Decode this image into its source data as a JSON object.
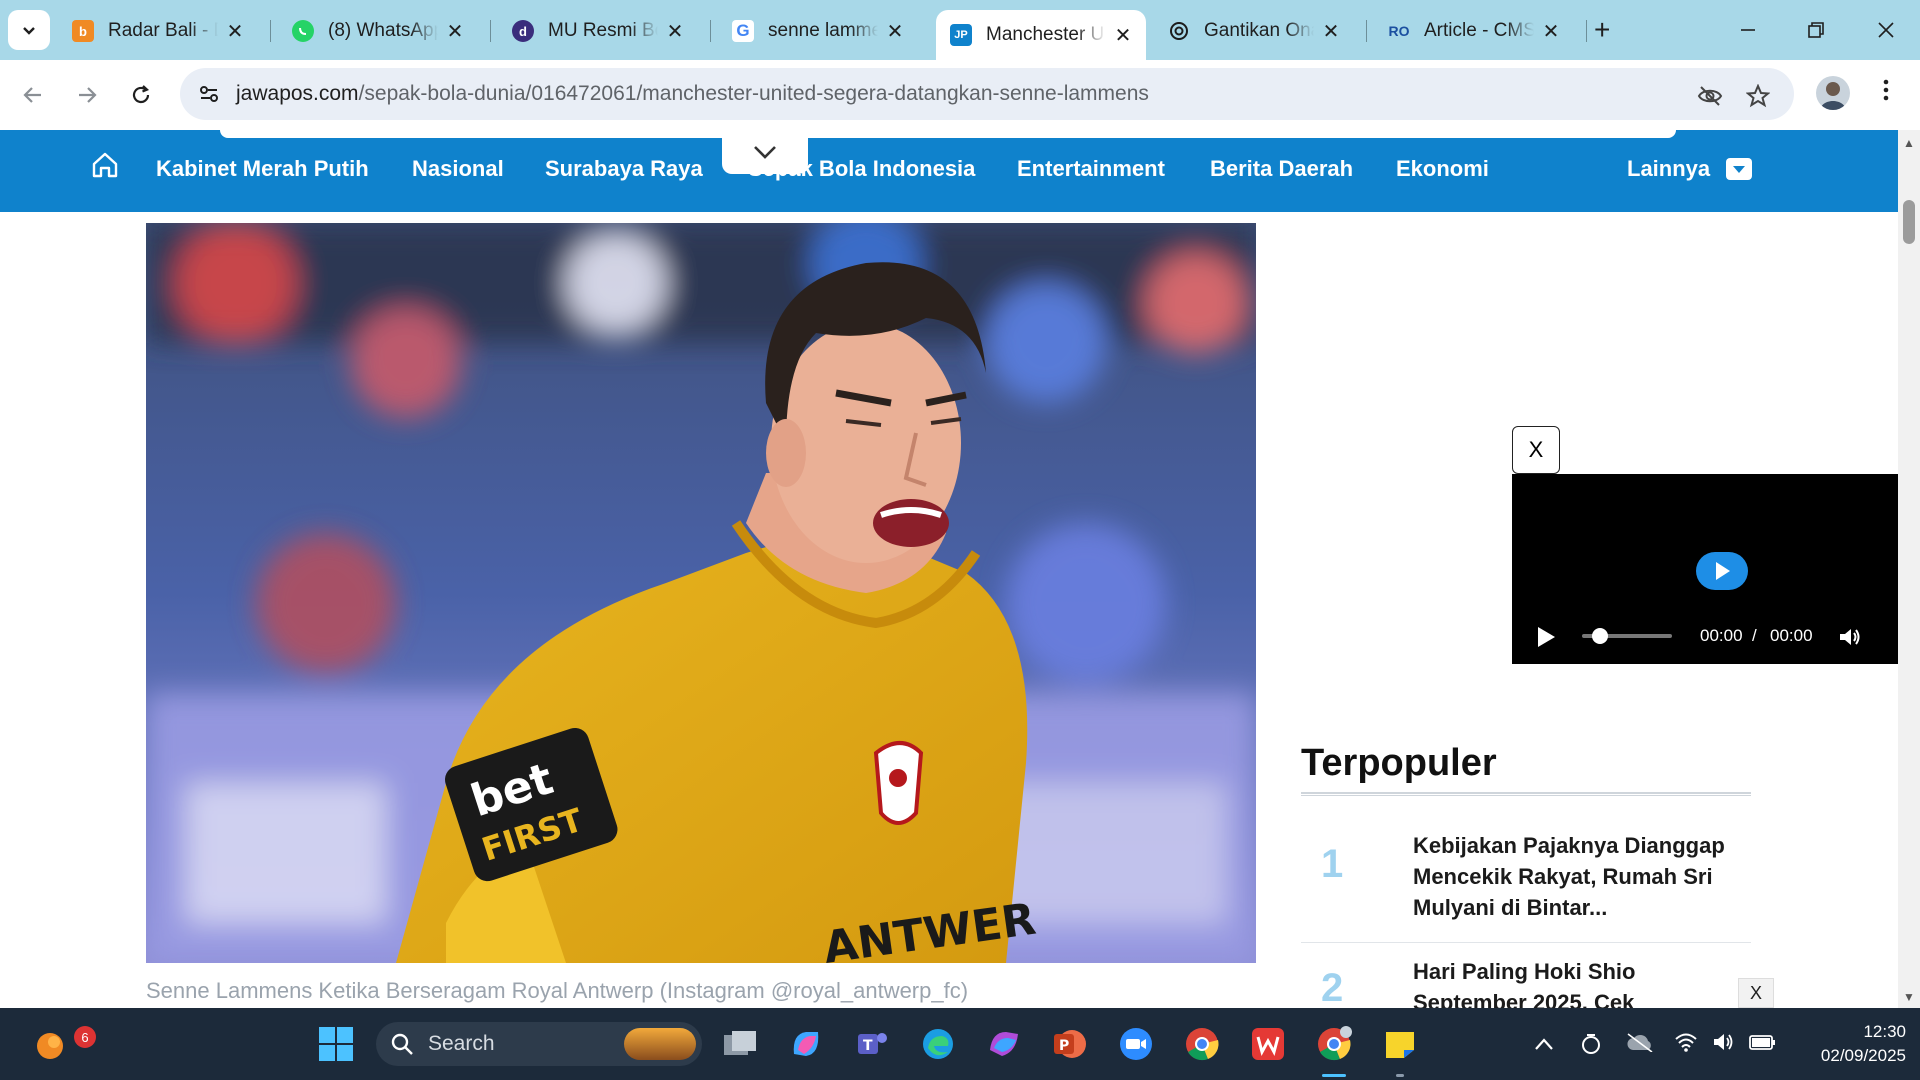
{
  "browser": {
    "tabs": [
      {
        "title": "Radar Bali - D",
        "favicon": "radar-bali-favicon",
        "favicon_color": "#f08a24",
        "favicon_text": "b",
        "active": false
      },
      {
        "title": "(8) WhatsApp",
        "favicon": "whatsapp-favicon",
        "favicon_color": "#25d366",
        "favicon_text": "",
        "active": false
      },
      {
        "title": "MU Resmi Boy",
        "favicon": "detik-favicon",
        "favicon_color": "#3a2d7c",
        "favicon_text": "d",
        "active": false
      },
      {
        "title": "senne lammer",
        "favicon": "google-favicon",
        "favicon_color": "#ffffff",
        "favicon_text": "G",
        "active": false
      },
      {
        "title": "Manchester U",
        "favicon": "jawapos-favicon",
        "favicon_color": "#0f82cc",
        "favicon_text": "JP",
        "active": true
      },
      {
        "title": "Gantikan Ona",
        "favicon": "chatgpt-favicon",
        "favicon_color": "#1c1c1c",
        "favicon_text": "",
        "active": false
      },
      {
        "title": "Article - CMS",
        "favicon": "cms-favicon",
        "favicon_color": "#1b4fa0",
        "favicon_text": "RO",
        "active": false
      }
    ],
    "close_glyph": "✕",
    "new_tab_glyph": "+",
    "url_domain": "jawapos.com",
    "url_path": "/sepak-bola-dunia/016472061/manchester-united-segera-datangkan-senne-lammens"
  },
  "site": {
    "accent": "#0f82cc",
    "nav": [
      "Kabinet Merah Putih",
      "Nasional",
      "Surabaya Raya",
      "Sepak Bola Indonesia",
      "Entertainment",
      "Berita Daerah",
      "Ekonomi"
    ],
    "more_label": "Lainnya"
  },
  "article": {
    "caption": "Senne Lammens Ketika Berseragam Royal Antwerp (Instagram @royal_antwerp_fc)",
    "sponsor_text_1": "bet",
    "sponsor_text_2": "FIRST",
    "kit_text": "ANTWER"
  },
  "video": {
    "close_label": "X",
    "current_time": "00:00",
    "separator": "/",
    "duration": "00:00",
    "progress": 0
  },
  "sidebar": {
    "title": "Terpopuler",
    "items": [
      {
        "rank": "1",
        "headline": "Kebijakan Pajaknya Dianggap Mencekik Rakyat, Rumah Sri Mulyani di Bintar..."
      },
      {
        "rank": "2",
        "headline": "Hari Paling Hoki Shio September 2025, Cek"
      }
    ],
    "ad_close_label": "X"
  },
  "taskbar": {
    "search_placeholder": "Search",
    "notification_count": "6",
    "time": "12:30",
    "date": "02/09/2025",
    "pinned": [
      "windows-start",
      "task-view",
      "copilot",
      "teams",
      "edge",
      "microsoft-365",
      "powerpoint",
      "zoom",
      "chrome",
      "wps-office",
      "chrome-profile",
      "sticky-notes"
    ]
  }
}
